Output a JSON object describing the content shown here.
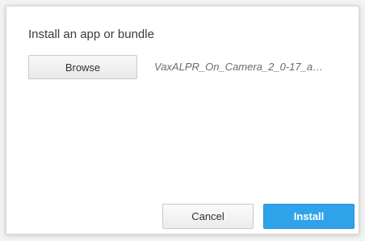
{
  "dialog": {
    "title": "Install an app or bundle",
    "browse_label": "Browse",
    "selected_file": "VaxALPR_On_Camera_2_0-17_a…",
    "cancel_label": "Cancel",
    "install_label": "Install"
  },
  "colors": {
    "primary_button": "#2fa3ea",
    "dialog_background": "#ffffff"
  }
}
